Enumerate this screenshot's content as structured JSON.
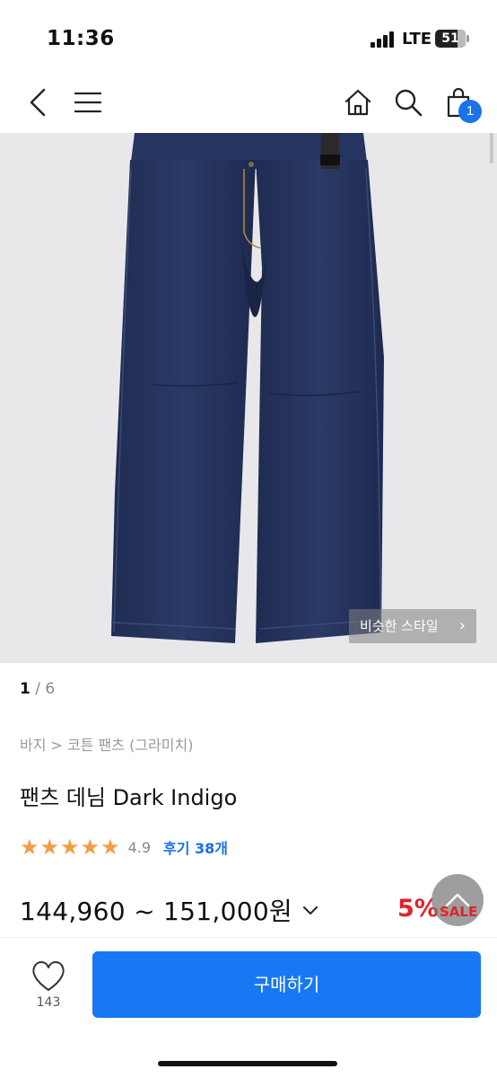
{
  "status_bar": {
    "time": "11:36",
    "network": "LTE",
    "battery": "51"
  },
  "nav": {
    "icons": [
      "back-icon",
      "menu-icon",
      "home-icon",
      "search-icon",
      "cart-icon"
    ],
    "cart_count": "1"
  },
  "gallery": {
    "similar_style_label": "비슷한 스타일",
    "current_index": "1",
    "separator": " / ",
    "total": "6"
  },
  "product": {
    "breadcrumb": "바지 > 코튼 팬츠 (그라미치)",
    "title": "팬츠 데님 Dark Indigo",
    "rating": 4.9,
    "rating_text": "4.9",
    "review_label": "후기 38개",
    "price_range": "144,960 ~ 151,000원",
    "discount": "5%",
    "sale_label": "SALE"
  },
  "bottom_bar": {
    "like_count": "143",
    "buy_label": "구매하기"
  },
  "colors": {
    "accent": "#1878f3",
    "star": "#f39c42",
    "sale": "#e0232a",
    "denim": "#26345e",
    "image_bg": "#e8e8ea"
  }
}
